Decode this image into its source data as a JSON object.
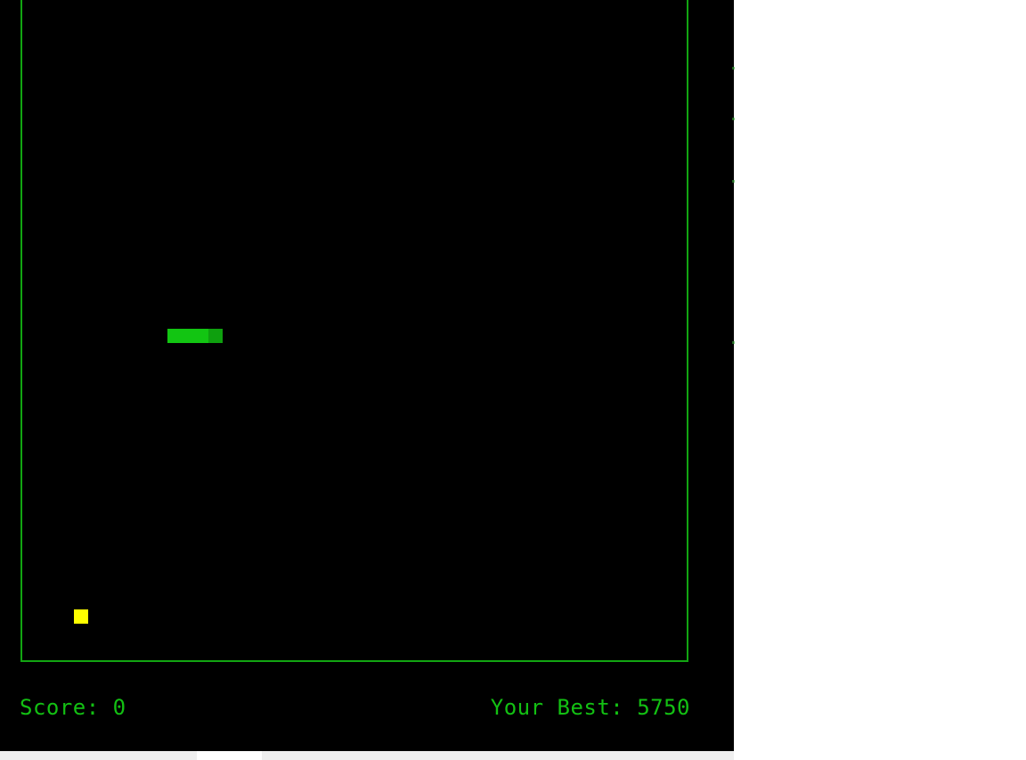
{
  "game": {
    "title": "Snake",
    "colors": {
      "background": "#000000",
      "border": "#12a512",
      "snake_body": "#12c512",
      "snake_head": "#0ea00e",
      "food": "#ffff00",
      "text": "#13c013"
    }
  },
  "hud": {
    "score_text": "Score: 0",
    "best_text": "Your Best: 5750"
  },
  "snake": {
    "direction": "right",
    "length_segments": 4
  }
}
